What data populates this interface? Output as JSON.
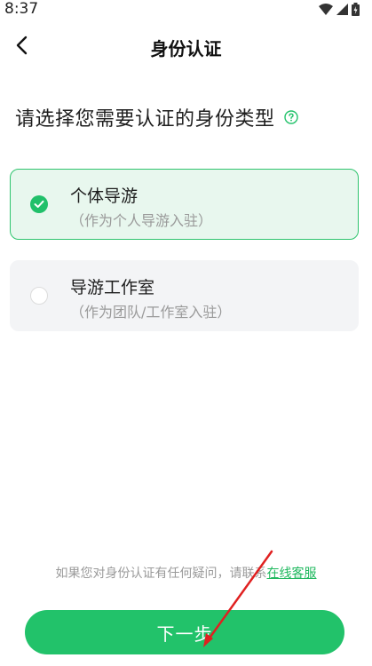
{
  "status_bar": {
    "time": "8:37"
  },
  "nav": {
    "title": "身份认证"
  },
  "question": "请选择您需要认证的身份类型",
  "options": [
    {
      "title": "个体导游",
      "subtitle": "（作为个人导游入驻）",
      "selected": true
    },
    {
      "title": "导游工作室",
      "subtitle": "（作为团队/工作室入驻）",
      "selected": false
    }
  ],
  "footer": {
    "note": "如果您对身份认证有任何疑问，请联系",
    "link": "在线客服"
  },
  "next_button": {
    "label": "下一步"
  },
  "colors": {
    "accent": "#22c26a",
    "selected_bg": "#e8f7ee",
    "annotation": "#e02020"
  }
}
